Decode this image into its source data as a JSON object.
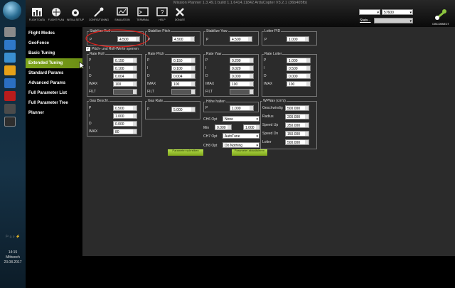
{
  "window": {
    "title": "Mission Planner 1.3.49.1 build 1.1.6414.11842 ArduCopter V3.2.1 (36b405fb)"
  },
  "toolbar": {
    "items": [
      {
        "label": "FLIGHT DATA",
        "icon": "flight-data-icon"
      },
      {
        "label": "FLIGHT PLAN",
        "icon": "flight-plan-icon"
      },
      {
        "label": "INITIAL SETUP",
        "icon": "initial-setup-icon"
      },
      {
        "label": "CONFIG/TUNING",
        "icon": "config-tuning-icon"
      },
      {
        "label": "SIMULATION",
        "icon": "simulation-icon"
      },
      {
        "label": "TERMINAL",
        "icon": "terminal-icon"
      },
      {
        "label": "HELP",
        "icon": "help-icon"
      },
      {
        "label": "DONATE",
        "icon": "donate-icon"
      }
    ],
    "baud": "57600",
    "stats": "Stats...",
    "connect": "DISCONNECT"
  },
  "taskbar": {
    "time": "14:15",
    "day": "Mittwoch",
    "date": "23.08.2017"
  },
  "sidebar": {
    "items": [
      {
        "label": "Flight Modes",
        "active": false
      },
      {
        "label": "GeoFence",
        "active": false
      },
      {
        "label": "Basic Tuning",
        "active": false
      },
      {
        "label": "Extended Tuning",
        "active": true
      },
      {
        "label": "Standard Params",
        "active": false
      },
      {
        "label": "Advanced Params",
        "active": false
      },
      {
        "label": "Full Parameter List",
        "active": false
      },
      {
        "label": "Full Parameter Tree",
        "active": false
      },
      {
        "label": "Planner",
        "active": false
      }
    ]
  },
  "tuning": {
    "stab_roll": {
      "title": "Stabilize Roll",
      "p_label": "P",
      "p": "4.500"
    },
    "stab_pitch": {
      "title": "Stabilize Pitch",
      "p_label": "P",
      "p": "4.500"
    },
    "stab_yaw": {
      "title": "Stabilize Yaw",
      "p_label": "P",
      "p": "4.500"
    },
    "loiter_pid": {
      "title": "Loiter PID",
      "p_label": "P",
      "p": "1.000"
    },
    "lock_label": "Pitch- und Roll-Werte sperren",
    "rate_roll": {
      "title": "Rate Roll",
      "l": [
        "P",
        "I",
        "D",
        "IMAX",
        "FILT"
      ],
      "v": [
        "0.150",
        "0.100",
        "0.004",
        "100",
        ""
      ]
    },
    "rate_pitch": {
      "title": "Rate Pitch",
      "l": [
        "P",
        "I",
        "D",
        "IMAX",
        "FILT"
      ],
      "v": [
        "0.150",
        "0.100",
        "0.004",
        "100",
        ""
      ]
    },
    "rate_yaw": {
      "title": "Rate Yaw",
      "l": [
        "P",
        "I",
        "D",
        "IMAX",
        "FILT"
      ],
      "v": [
        "0.200",
        "0.020",
        "0.000",
        "100",
        ""
      ]
    },
    "rate_loiter": {
      "title": "Rate Loiter",
      "l": [
        "P",
        "I",
        "D",
        "IMAX"
      ],
      "v": [
        "1.000",
        "0.500",
        "0.000",
        "100"
      ]
    },
    "gas_accel": {
      "title": "Gas Beschl.",
      "l": [
        "P",
        "I",
        "D",
        "IMAX"
      ],
      "v": [
        "0.500",
        "1.000",
        "0.000",
        "80"
      ]
    },
    "gas_rate": {
      "title": "Gas Rate",
      "p_label": "P",
      "p": "5.000"
    },
    "alt_hold": {
      "title": "Höhe halten",
      "p_label": "P",
      "p": "1.000"
    },
    "ch6": {
      "label": "CH6 Opt",
      "value": "None",
      "min_label": "Min",
      "min": "0.000",
      "max": "1.000"
    },
    "ch7": {
      "label": "CH7 Opt",
      "value": "AutoTune"
    },
    "ch8": {
      "label": "CH8 Opt",
      "value": "Do Nothing"
    },
    "wpnav": {
      "title": "WPNav (cm's)",
      "l": [
        "Geschwindig",
        "Radius",
        "Speed Up",
        "Speed Dn",
        "Loiter"
      ],
      "v": [
        "500.000",
        "200.000",
        "250.000",
        "150.000",
        "500.000"
      ]
    },
    "write_btn": "Parameter schreiben",
    "refresh_btn": "Parameter aktualisieren"
  }
}
